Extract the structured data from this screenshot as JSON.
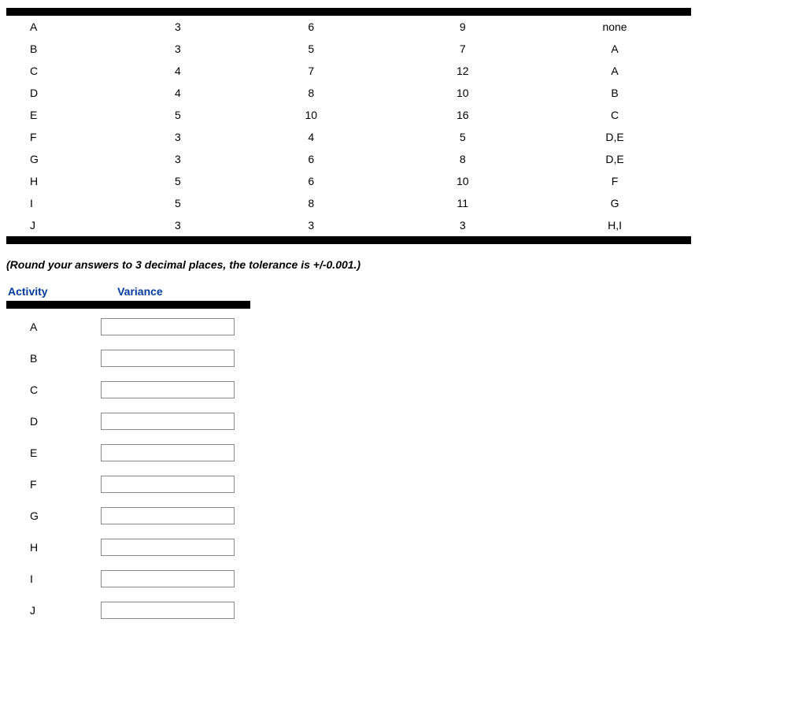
{
  "table": {
    "rows": [
      {
        "activity": "A",
        "c1": "3",
        "c2": "6",
        "c3": "9",
        "predecessor": "none"
      },
      {
        "activity": "B",
        "c1": "3",
        "c2": "5",
        "c3": "7",
        "predecessor": "A"
      },
      {
        "activity": "C",
        "c1": "4",
        "c2": "7",
        "c3": "12",
        "predecessor": "A"
      },
      {
        "activity": "D",
        "c1": "4",
        "c2": "8",
        "c3": "10",
        "predecessor": "B"
      },
      {
        "activity": "E",
        "c1": "5",
        "c2": "10",
        "c3": "16",
        "predecessor": "C"
      },
      {
        "activity": "F",
        "c1": "3",
        "c2": "4",
        "c3": "5",
        "predecessor": "D,E"
      },
      {
        "activity": "G",
        "c1": "3",
        "c2": "6",
        "c3": "8",
        "predecessor": "D,E"
      },
      {
        "activity": "H",
        "c1": "5",
        "c2": "6",
        "c3": "10",
        "predecessor": "F"
      },
      {
        "activity": "I",
        "c1": "5",
        "c2": "8",
        "c3": "11",
        "predecessor": "G"
      },
      {
        "activity": "J",
        "c1": "3",
        "c2": "3",
        "c3": "3",
        "predecessor": "H,I"
      }
    ]
  },
  "instruction": "(Round your answers to 3 decimal places, the tolerance is +/-0.001.)",
  "answers": {
    "headers": {
      "activity": "Activity",
      "variance": "Variance"
    },
    "rows": [
      {
        "activity": "A",
        "value": ""
      },
      {
        "activity": "B",
        "value": ""
      },
      {
        "activity": "C",
        "value": ""
      },
      {
        "activity": "D",
        "value": ""
      },
      {
        "activity": "E",
        "value": ""
      },
      {
        "activity": "F",
        "value": ""
      },
      {
        "activity": "G",
        "value": ""
      },
      {
        "activity": "H",
        "value": ""
      },
      {
        "activity": "I",
        "value": ""
      },
      {
        "activity": "J",
        "value": ""
      }
    ]
  }
}
